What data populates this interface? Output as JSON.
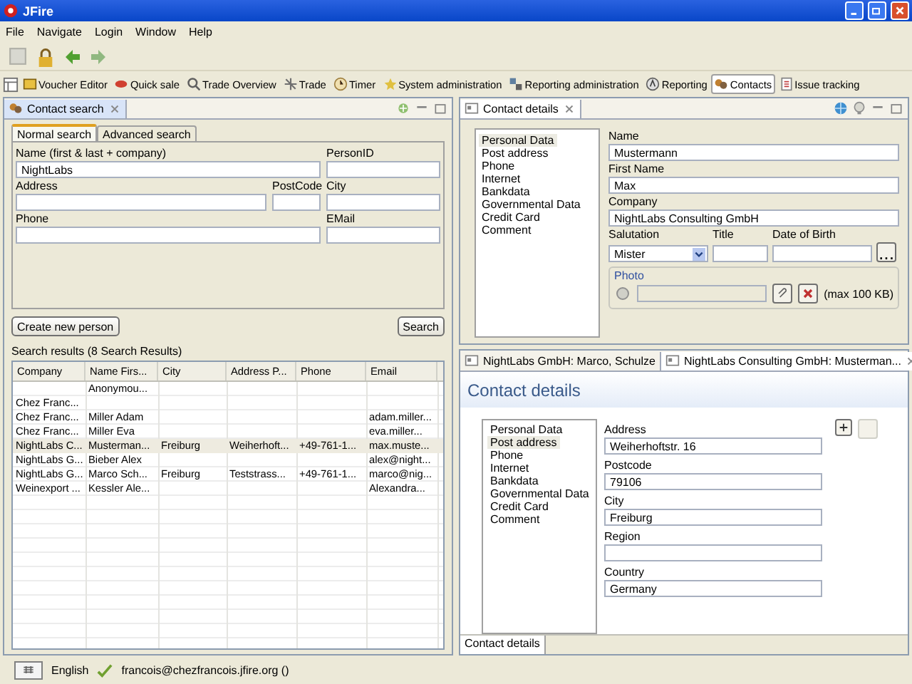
{
  "window": {
    "title": "JFire"
  },
  "menu": [
    "File",
    "Navigate",
    "Login",
    "Window",
    "Help"
  ],
  "perspectives": [
    {
      "label": "Voucher Editor",
      "selected": false
    },
    {
      "label": "Quick sale",
      "selected": false
    },
    {
      "label": "Trade Overview",
      "selected": false
    },
    {
      "label": "Trade",
      "selected": false
    },
    {
      "label": "Timer",
      "selected": false
    },
    {
      "label": "System administration",
      "selected": false
    },
    {
      "label": "Reporting administration",
      "selected": false
    },
    {
      "label": "Reporting",
      "selected": false
    },
    {
      "label": "Contacts",
      "selected": true
    },
    {
      "label": "Issue tracking",
      "selected": false
    }
  ],
  "search_view": {
    "title": "Contact search",
    "tabs": [
      {
        "label": "Normal search",
        "selected": true
      },
      {
        "label": "Advanced search",
        "selected": false
      }
    ],
    "fields": {
      "name_label": "Name (first & last + company)",
      "name": "NightLabs",
      "person_id_label": "PersonID",
      "address_label": "Address",
      "postcode_label": "PostCode",
      "city_label": "City",
      "phone_label": "Phone",
      "email_label": "EMail"
    },
    "create_button": "Create new person",
    "search_button": "Search",
    "results_label": "Search results (8 Search Results)",
    "table": {
      "columns": [
        "Company",
        "Name Firs...",
        "City",
        "Address P...",
        "Phone",
        "Email"
      ],
      "rows": [
        {
          "selected": false,
          "cells": {
            "name": "Anonymou..."
          }
        },
        {
          "selected": false,
          "cells": {
            "company": "Chez Franc..."
          }
        },
        {
          "selected": false,
          "cells": {
            "company": "Chez Franc...",
            "name": "Miller  Adam",
            "email": "adam.miller..."
          }
        },
        {
          "selected": false,
          "cells": {
            "company": "Chez Franc...",
            "name": "Miller  Eva",
            "email": "eva.miller..."
          }
        },
        {
          "selected": true,
          "cells": {
            "company": "NightLabs C...",
            "name": "Musterman...",
            "city": "Freiburg",
            "address": "Weiherhoft...",
            "phone": "+49-761-1...",
            "email": "max.muste..."
          }
        },
        {
          "selected": false,
          "cells": {
            "company": "NightLabs G...",
            "name": "Bieber  Alex",
            "email": "alex@night..."
          }
        },
        {
          "selected": false,
          "cells": {
            "company": "NightLabs G...",
            "name": "Marco  Sch...",
            "city": "Freiburg",
            "address": "Teststrass...",
            "phone": "+49-761-1...",
            "email": "marco@nig..."
          }
        },
        {
          "selected": false,
          "cells": {
            "company": "Weinexport ...",
            "name": "Kessler  Ale...",
            "email": "Alexandra..."
          }
        }
      ]
    }
  },
  "contact_view": {
    "title": "Contact details",
    "sections": [
      {
        "label": "Personal Data",
        "selected": true
      },
      {
        "label": "Post address",
        "selected": false
      },
      {
        "label": "Phone",
        "selected": false
      },
      {
        "label": "Internet",
        "selected": false
      },
      {
        "label": "Bankdata",
        "selected": false
      },
      {
        "label": "Governmental Data",
        "selected": false
      },
      {
        "label": "Credit Card",
        "selected": false
      },
      {
        "label": "Comment",
        "selected": false
      }
    ],
    "name_label": "Name",
    "name": "Mustermann",
    "first_name_label": "First Name",
    "first_name": "Max",
    "company_label": "Company",
    "company": "NightLabs Consulting GmbH",
    "salutation_label": "Salutation",
    "salutation": "Mister",
    "title_label": "Title",
    "birth_label": "Date of Birth",
    "date_button": "...",
    "photo_label": "Photo",
    "photo_note": "(max 100 KB)"
  },
  "editor": {
    "tabs": [
      {
        "label": "NightLabs GmbH: Marco, Schulze",
        "selected": false
      },
      {
        "label": "NightLabs Consulting GmbH: Musterman...",
        "selected": true
      }
    ],
    "heading": "Contact details",
    "sections": [
      {
        "label": "Personal Data",
        "selected": false
      },
      {
        "label": "Post address",
        "selected": true
      },
      {
        "label": "Phone",
        "selected": false
      },
      {
        "label": "Internet",
        "selected": false
      },
      {
        "label": "Bankdata",
        "selected": false
      },
      {
        "label": "Governmental Data",
        "selected": false
      },
      {
        "label": "Credit Card",
        "selected": false
      },
      {
        "label": "Comment",
        "selected": false
      }
    ],
    "fields": [
      {
        "label": "Address",
        "value": "Weiherhoftstr. 16"
      },
      {
        "label": "Postcode",
        "value": "79106"
      },
      {
        "label": "City",
        "value": "Freiburg"
      },
      {
        "label": "Region"
      },
      {
        "label": "Country",
        "value": "Germany"
      }
    ],
    "page_tab": "Contact details"
  },
  "status_bar": {
    "language": "English",
    "user": "francois@chezfrancois.jfire.org ()"
  }
}
